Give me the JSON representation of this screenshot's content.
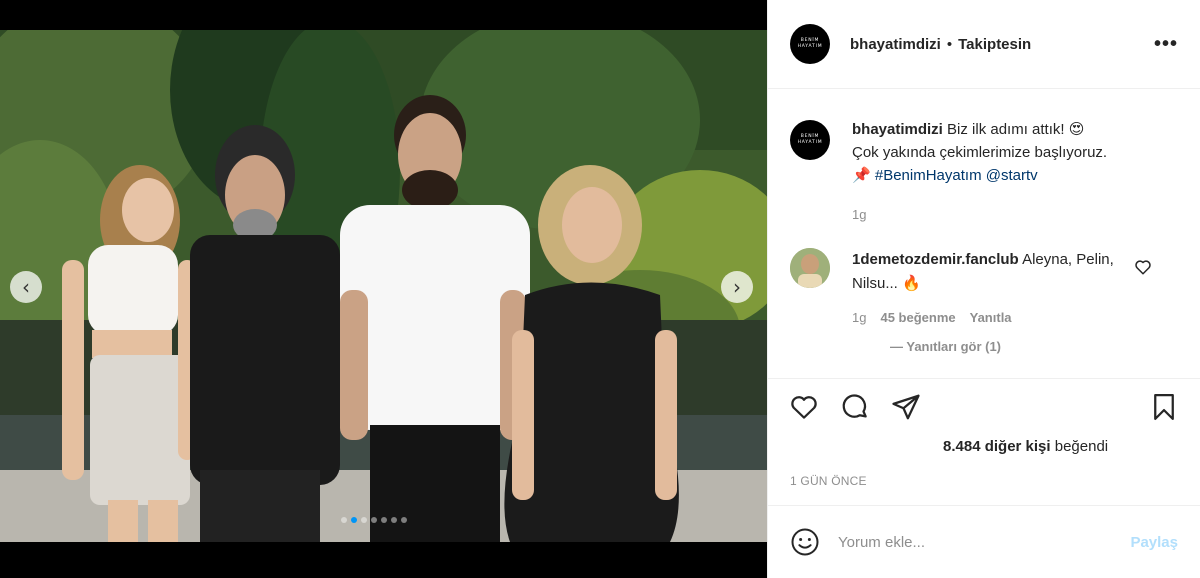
{
  "post": {
    "media": {
      "carousel_count": 7,
      "carousel_active_index": 1,
      "prev_icon": "chevron-left-icon",
      "next_icon": "chevron-right-icon"
    },
    "header": {
      "username": "bhayatimdizi",
      "separator": "•",
      "follow_status": "Takiptesin",
      "more_icon": "more-options-icon",
      "more_label": "•••",
      "avatar_logo_lines": [
        "BENİM",
        "HAYATIM"
      ]
    },
    "caption": {
      "username": "bhayatimdizi",
      "text_part1": "Biz ilk adımı attık! 😍",
      "text_part2": "Çok yakında çekimlerimize başlıyoruz.",
      "pin": "📌",
      "hashtag": "#BenimHayatım",
      "mention": "@startv",
      "time": "1g"
    },
    "comment": {
      "username": "1demetozdemir.fanclub",
      "text": "Aleyna, Pelin, Nilsu... 🔥",
      "time": "1g",
      "likes": "45 beğenme",
      "reply": "Yanıtla",
      "view_replies": "— Yanıtları gör (1)"
    },
    "actions": {
      "like_icon": "heart-icon",
      "comment_icon": "comment-icon",
      "share_icon": "send-icon",
      "save_icon": "bookmark-icon"
    },
    "likes_text_count": "8.484 diğer kişi",
    "likes_text_suffix": "beğendi",
    "time_ago": "1 GÜN ÖNCE",
    "add_comment": {
      "placeholder": "Yorum ekle...",
      "submit_label": "Paylaş",
      "emoji_icon": "emoji-icon"
    },
    "colors": {
      "accent": "#0095f6",
      "link": "#00376b",
      "share_disabled": "#b2dffc",
      "muted": "#8e8e8e"
    }
  }
}
